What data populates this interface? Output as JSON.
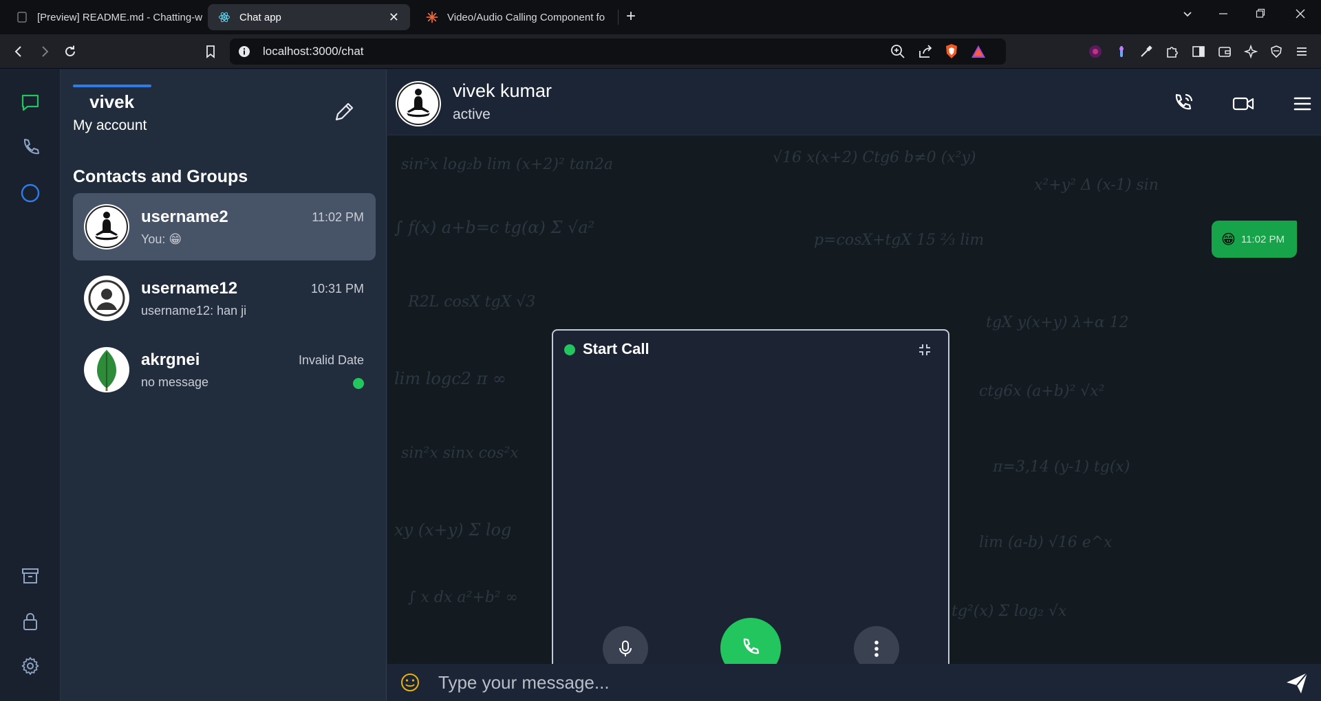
{
  "browser": {
    "tabs": [
      {
        "label": "[Preview] README.md - Chatting-w",
        "icon": "file-icon"
      },
      {
        "label": "Chat app",
        "icon": "react-icon"
      },
      {
        "label": "Video/Audio Calling Component fo",
        "icon": "spark-icon"
      }
    ],
    "url": "localhost:3000/chat"
  },
  "account": {
    "name": "vivek",
    "subtitle": "My account"
  },
  "contacts_title": "Contacts and Groups",
  "contacts": [
    {
      "name": "username2",
      "time": "11:02 PM",
      "preview": "You: 😁",
      "avatar": "meditation-avatar"
    },
    {
      "name": "username12",
      "time": "10:31 PM",
      "preview": "username12: han ji",
      "avatar": "default-user-avatar"
    },
    {
      "name": "akrgnei",
      "time": "Invalid Date",
      "preview": "no message",
      "avatar": "leaf-avatar"
    }
  ],
  "chat": {
    "name": "vivek kumar",
    "status": "active"
  },
  "messages": [
    {
      "text": "😁",
      "time": "11:02 PM",
      "outgoing": true
    }
  ],
  "call": {
    "title": "Start Call"
  },
  "composer": {
    "placeholder": "Type your message..."
  },
  "colors": {
    "accent_green": "#22c55e",
    "accent_blue": "#2f7be8",
    "bubble_green": "#16a34a"
  }
}
